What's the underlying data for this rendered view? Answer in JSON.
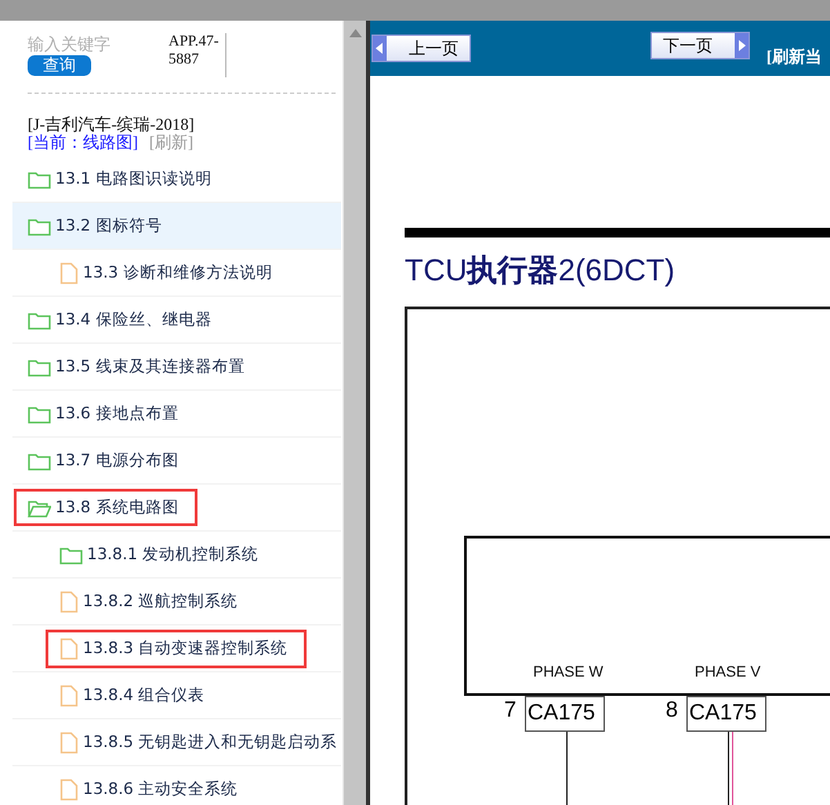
{
  "search": {
    "placeholder": "输入关键字",
    "button": "查询",
    "app_code": "APP.47-5887"
  },
  "book": {
    "title": "[J-吉利汽车-缤瑞-2018]",
    "current": "[当前：线路图]",
    "refresh": "[刷新]"
  },
  "tree": [
    {
      "label": "13.1 电路图识读说明",
      "kind": "folder",
      "expanded": false,
      "selected": false,
      "marked": false
    },
    {
      "label": "13.2 图标符号",
      "kind": "folder",
      "expanded": false,
      "selected": true,
      "marked": false,
      "children": [
        {
          "label": "13.3 诊断和维修方法说明",
          "kind": "file",
          "selected": false,
          "marked": false
        }
      ]
    },
    {
      "label": "13.4 保险丝、继电器",
      "kind": "folder",
      "expanded": false,
      "selected": false,
      "marked": false
    },
    {
      "label": "13.5 线束及其连接器布置",
      "kind": "folder",
      "expanded": false,
      "selected": false,
      "marked": false
    },
    {
      "label": "13.6 接地点布置",
      "kind": "folder",
      "expanded": false,
      "selected": false,
      "marked": false
    },
    {
      "label": "13.7 电源分布图",
      "kind": "folder",
      "expanded": false,
      "selected": false,
      "marked": false
    },
    {
      "label": "13.8 系统电路图",
      "kind": "folder",
      "expanded": true,
      "selected": false,
      "marked": true,
      "children": [
        {
          "label": "13.8.1 发动机控制系统",
          "kind": "folder",
          "expanded": false,
          "selected": false,
          "marked": false
        },
        {
          "label": "13.8.2 巡航控制系统",
          "kind": "file",
          "selected": false,
          "marked": false
        },
        {
          "label": "13.8.3 自动变速器控制系统",
          "kind": "file",
          "selected": false,
          "marked": true
        },
        {
          "label": "13.8.4 组合仪表",
          "kind": "file",
          "selected": false,
          "marked": false
        },
        {
          "label": "13.8.5 无钥匙进入和无钥匙启动系",
          "kind": "file",
          "selected": false,
          "marked": false
        },
        {
          "label": "13.8.6 主动安全系统",
          "kind": "file",
          "selected": false,
          "marked": false
        }
      ]
    }
  ],
  "toolbar": {
    "prev": "上一页",
    "next": "下一页",
    "refresh": "[刷新当"
  },
  "diagram": {
    "title": "TCU**执行器**2(6DCT)",
    "pins": [
      {
        "phase": "PHASE W",
        "number": "7",
        "connector": "CA175"
      },
      {
        "phase": "PHASE V",
        "number": "8",
        "connector": "CA175"
      }
    ]
  }
}
